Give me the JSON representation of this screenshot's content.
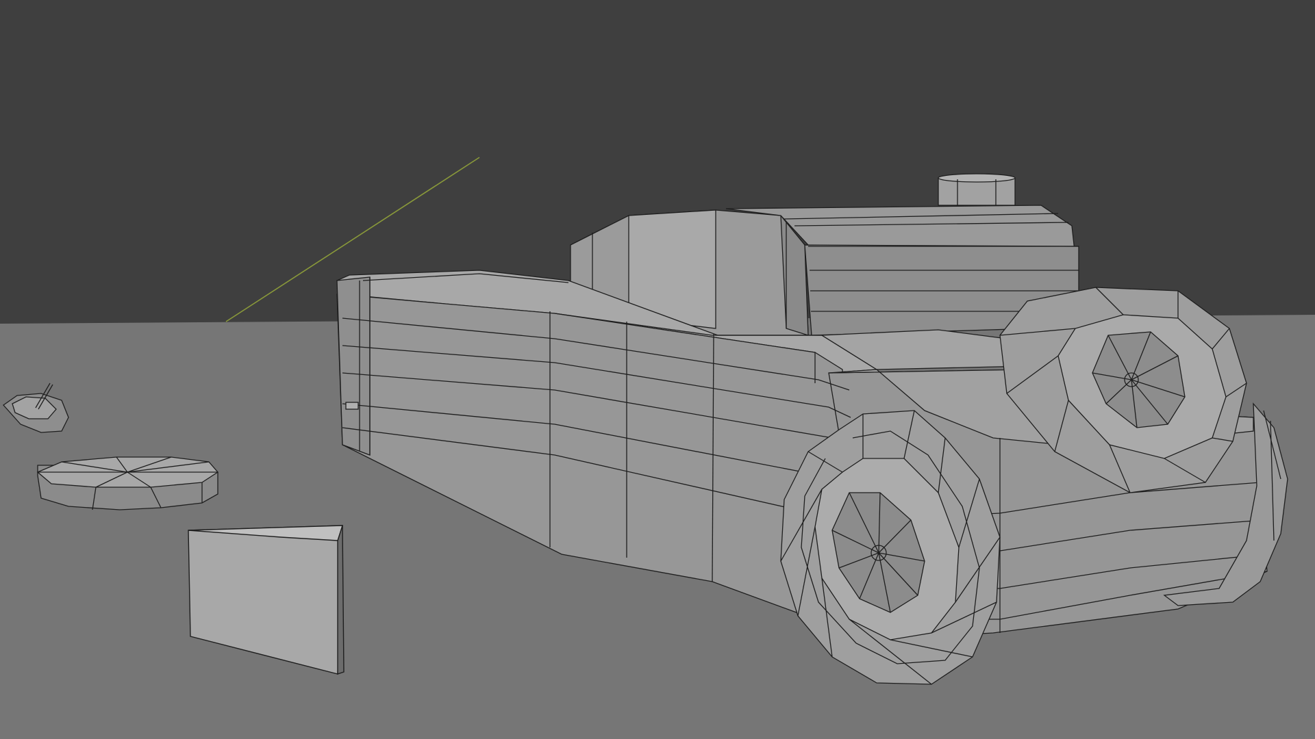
{
  "viewport": {
    "mode": "3D viewport",
    "shading": "solid",
    "wireframe_overlay": true,
    "colors": {
      "world_background": "#3f3f3f",
      "ground": "#767676",
      "mesh_light": "#a3a3a3",
      "mesh_mid": "#8d8d8d",
      "mesh_dark": "#6c6c6c",
      "wire": "#1e1e1e",
      "axis_line": "#8a9a3a"
    }
  },
  "scene_objects": [
    {
      "name": "car-body",
      "kind": "mesh"
    },
    {
      "name": "car-cabin",
      "kind": "mesh"
    },
    {
      "name": "roof-cylinder",
      "kind": "mesh"
    },
    {
      "name": "front-wheel",
      "kind": "mesh"
    },
    {
      "name": "rear-wheel",
      "kind": "mesh"
    },
    {
      "name": "far-wheel",
      "kind": "mesh"
    },
    {
      "name": "octagon-disc",
      "kind": "mesh"
    },
    {
      "name": "small-disc-with-stick",
      "kind": "mesh"
    },
    {
      "name": "wedge-prism",
      "kind": "mesh"
    }
  ]
}
